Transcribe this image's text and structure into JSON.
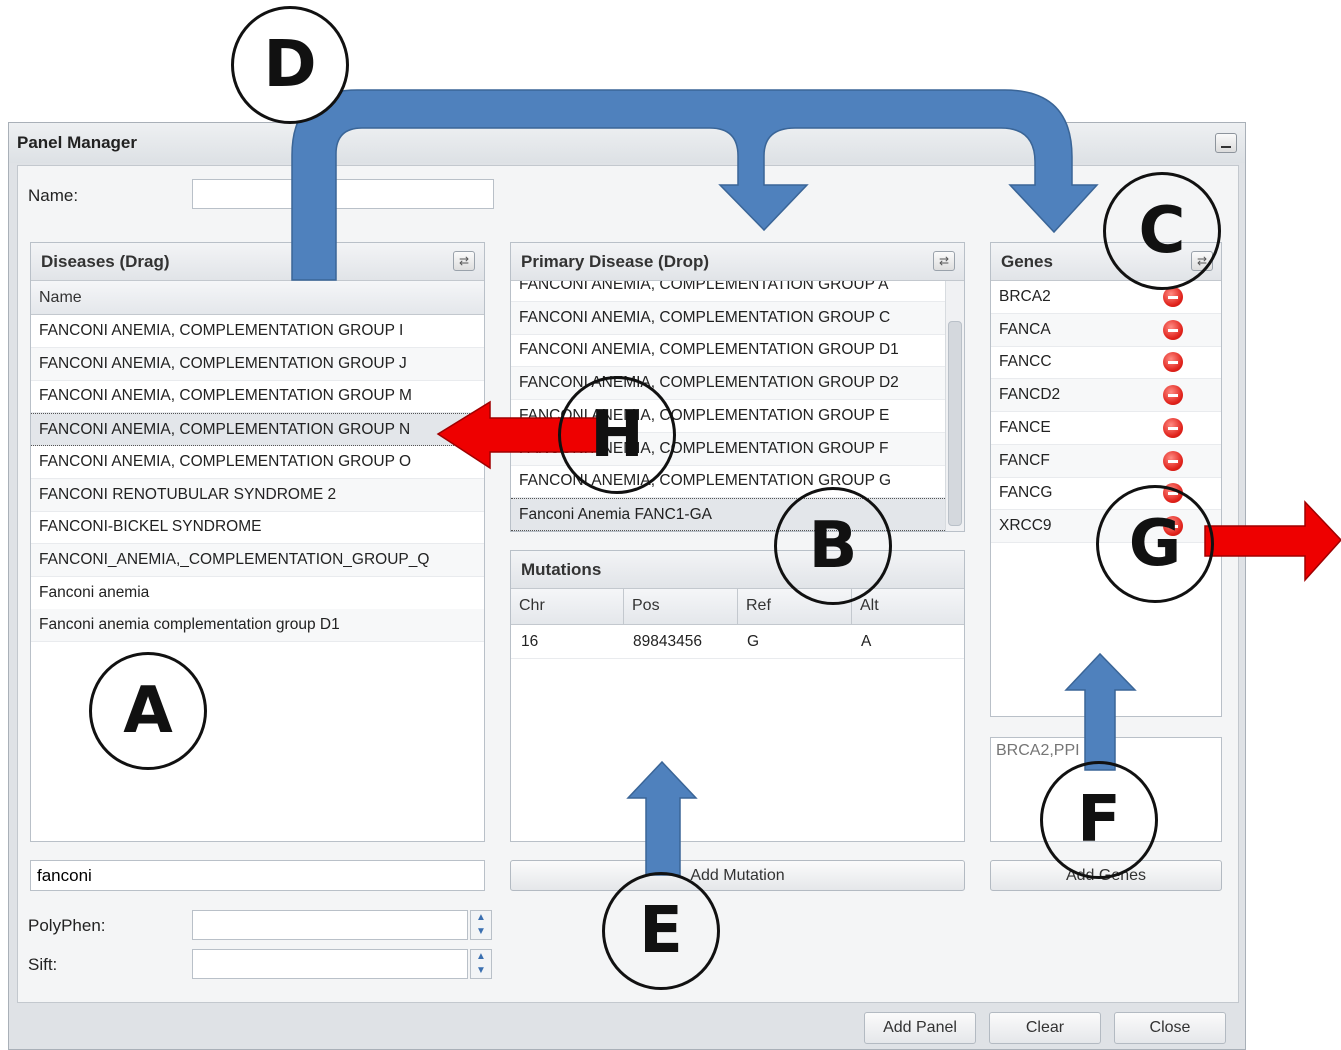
{
  "window": {
    "title": "Panel Manager"
  },
  "name_field": {
    "label": "Name:",
    "value": ""
  },
  "diseases": {
    "header": "Diseases (Drag)",
    "column": "Name",
    "rows": [
      "FANCONI ANEMIA, COMPLEMENTATION GROUP I",
      "FANCONI ANEMIA, COMPLEMENTATION GROUP J",
      "FANCONI ANEMIA, COMPLEMENTATION GROUP M",
      "FANCONI ANEMIA, COMPLEMENTATION GROUP N",
      "FANCONI ANEMIA, COMPLEMENTATION GROUP O",
      "FANCONI RENOTUBULAR SYNDROME 2",
      "FANCONI-BICKEL SYNDROME",
      "FANCONI_ANEMIA,_COMPLEMENTATION_GROUP_Q",
      "Fanconi anemia",
      "Fanconi anemia complementation group D1"
    ],
    "selected_index": 3,
    "search_value": "fanconi"
  },
  "primary_disease": {
    "header": "Primary Disease (Drop)",
    "rows": [
      "FANCONI ANEMIA, COMPLEMENTATION GROUP A",
      "FANCONI ANEMIA, COMPLEMENTATION GROUP C",
      "FANCONI ANEMIA, COMPLEMENTATION GROUP D1",
      "FANCONI ANEMIA, COMPLEMENTATION GROUP D2",
      "FANCONI ANEMIA, COMPLEMENTATION GROUP E",
      "FANCONI ANEMIA, COMPLEMENTATION GROUP F",
      "FANCONI ANEMIA, COMPLEMENTATION GROUP G",
      "Fanconi Anemia FANC1-GA"
    ],
    "selected_index": 7
  },
  "mutations": {
    "header": "Mutations",
    "columns": [
      "Chr",
      "Pos",
      "Ref",
      "Alt"
    ],
    "rows": [
      [
        "16",
        "89843456",
        "G",
        "A"
      ]
    ],
    "add_button": "Add Mutation"
  },
  "genes": {
    "header": "Genes",
    "items": [
      "BRCA2",
      "FANCA",
      "FANCC",
      "FANCD2",
      "FANCE",
      "FANCF",
      "FANCG",
      "XRCC9"
    ],
    "input_placeholder": "BRCA2,PPI",
    "add_button": "Add Genes"
  },
  "scores": {
    "polyphen_label": "PolyPhen:",
    "sift_label": "Sift:"
  },
  "footer": {
    "add_panel": "Add Panel",
    "clear": "Clear",
    "close": "Close"
  },
  "callouts": {
    "A": "A",
    "B": "B",
    "C": "C",
    "D": "D",
    "E": "E",
    "F": "F",
    "G": "G",
    "H": "H"
  },
  "colors": {
    "flow_arrow": "#4f81bd",
    "action_arrow": "#ee0000",
    "remove_icon": "#e0211a"
  }
}
